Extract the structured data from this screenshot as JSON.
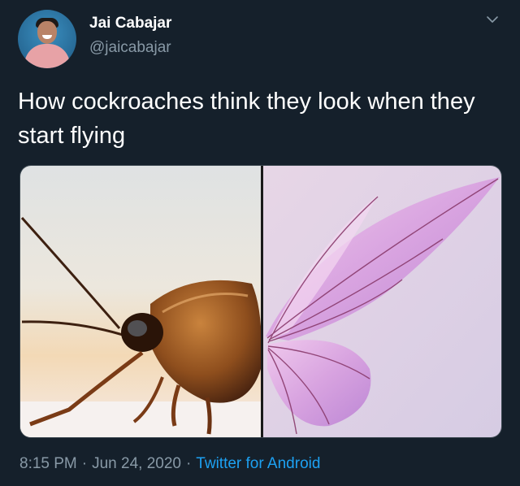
{
  "author": {
    "name": "Jai Cabajar",
    "handle": "@jaicabajar"
  },
  "tweet": {
    "text": "How cockroaches think they look when they start flying"
  },
  "meta": {
    "time": "8:15 PM",
    "separator": "·",
    "date": "Jun 24, 2020",
    "source": "Twitter for Android"
  },
  "colors": {
    "background": "#15202b",
    "secondary_text": "#8899a6",
    "link": "#1da1f2"
  },
  "icons": {
    "menu": "chevron-down-icon"
  }
}
